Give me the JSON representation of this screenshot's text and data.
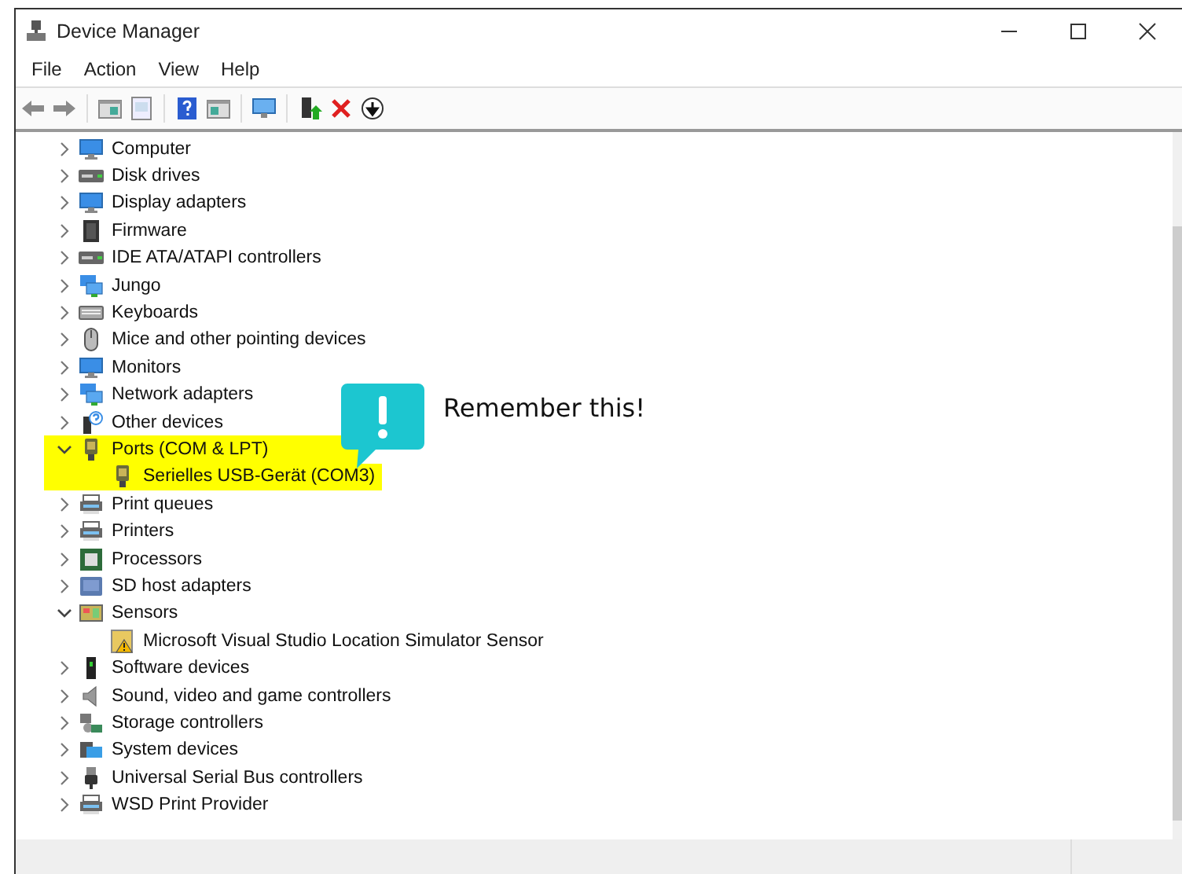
{
  "window": {
    "title": "Device Manager"
  },
  "menu": [
    "File",
    "Action",
    "View",
    "Help"
  ],
  "toolbar": [
    {
      "kind": "back"
    },
    {
      "kind": "forward"
    },
    {
      "kind": "sep"
    },
    {
      "kind": "panel"
    },
    {
      "kind": "properties"
    },
    {
      "kind": "sep"
    },
    {
      "kind": "help"
    },
    {
      "kind": "panel2"
    },
    {
      "kind": "sep"
    },
    {
      "kind": "scan"
    },
    {
      "kind": "sep"
    },
    {
      "kind": "update"
    },
    {
      "kind": "remove"
    },
    {
      "kind": "download"
    }
  ],
  "tree": {
    "nodes": [
      {
        "label": "Computer",
        "kind": "monitor",
        "expanded": false,
        "highlighted": false
      },
      {
        "label": "Disk drives",
        "kind": "drive",
        "expanded": false,
        "highlighted": false
      },
      {
        "label": "Display adapters",
        "kind": "monitor",
        "expanded": false,
        "highlighted": false
      },
      {
        "label": "Firmware",
        "kind": "firmware",
        "expanded": false,
        "highlighted": false
      },
      {
        "label": "IDE ATA/ATAPI controllers",
        "kind": "drive",
        "expanded": false,
        "highlighted": false
      },
      {
        "label": "Jungo",
        "kind": "network",
        "expanded": false,
        "highlighted": false
      },
      {
        "label": "Keyboards",
        "kind": "keyboard",
        "expanded": false,
        "highlighted": false
      },
      {
        "label": "Mice and other pointing devices",
        "kind": "mouse",
        "expanded": false,
        "highlighted": false
      },
      {
        "label": "Monitors",
        "kind": "monitor",
        "expanded": false,
        "highlighted": false
      },
      {
        "label": "Network adapters",
        "kind": "network",
        "expanded": false,
        "highlighted": false
      },
      {
        "label": "Other devices",
        "kind": "other",
        "expanded": false,
        "highlighted": false
      },
      {
        "label": "Ports (COM & LPT)",
        "kind": "port",
        "expanded": true,
        "highlighted": true,
        "children": [
          {
            "label": "Serielles USB-Gerät (COM3)",
            "kind": "port",
            "highlighted": true
          }
        ]
      },
      {
        "label": "Print queues",
        "kind": "printer",
        "expanded": false,
        "highlighted": false
      },
      {
        "label": "Printers",
        "kind": "printer",
        "expanded": false,
        "highlighted": false
      },
      {
        "label": "Processors",
        "kind": "processor",
        "expanded": false,
        "highlighted": false
      },
      {
        "label": "SD host adapters",
        "kind": "card",
        "expanded": false,
        "highlighted": false
      },
      {
        "label": "Sensors",
        "kind": "sensor",
        "expanded": true,
        "highlighted": false,
        "children": [
          {
            "label": "Microsoft Visual Studio Location Simulator Sensor",
            "kind": "warning",
            "highlighted": false
          }
        ]
      },
      {
        "label": "Software devices",
        "kind": "tower",
        "expanded": false,
        "highlighted": false
      },
      {
        "label": "Sound, video and game controllers",
        "kind": "speaker",
        "expanded": false,
        "highlighted": false
      },
      {
        "label": "Storage controllers",
        "kind": "storage",
        "expanded": false,
        "highlighted": false
      },
      {
        "label": "System devices",
        "kind": "system",
        "expanded": false,
        "highlighted": false
      },
      {
        "label": "Universal Serial Bus controllers",
        "kind": "usb",
        "expanded": false,
        "highlighted": false
      },
      {
        "label": "WSD Print Provider",
        "kind": "printer",
        "expanded": false,
        "highlighted": false
      }
    ]
  },
  "callout": {
    "text": "Remember this!"
  }
}
